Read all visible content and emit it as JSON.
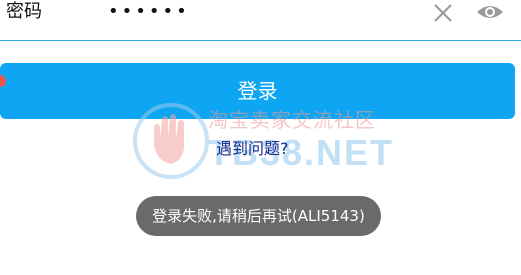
{
  "password_field": {
    "label": "密码",
    "value": "••••••"
  },
  "icons": {
    "clear": "close-icon",
    "visibility": "eye-icon"
  },
  "login_button": {
    "label": "登录"
  },
  "problem_link": {
    "label": "遇到问题?"
  },
  "toast": {
    "message": "登录失败,请稍后再试(ALI5143)"
  },
  "watermark": {
    "text_cn": "淘宝卖家交流社区",
    "text_en": "TB38.NET"
  },
  "colors": {
    "accent": "#0ea6f2",
    "underline": "#2aa7e0",
    "link": "#1a2a8c",
    "toast_bg": "#6a6a6a"
  }
}
